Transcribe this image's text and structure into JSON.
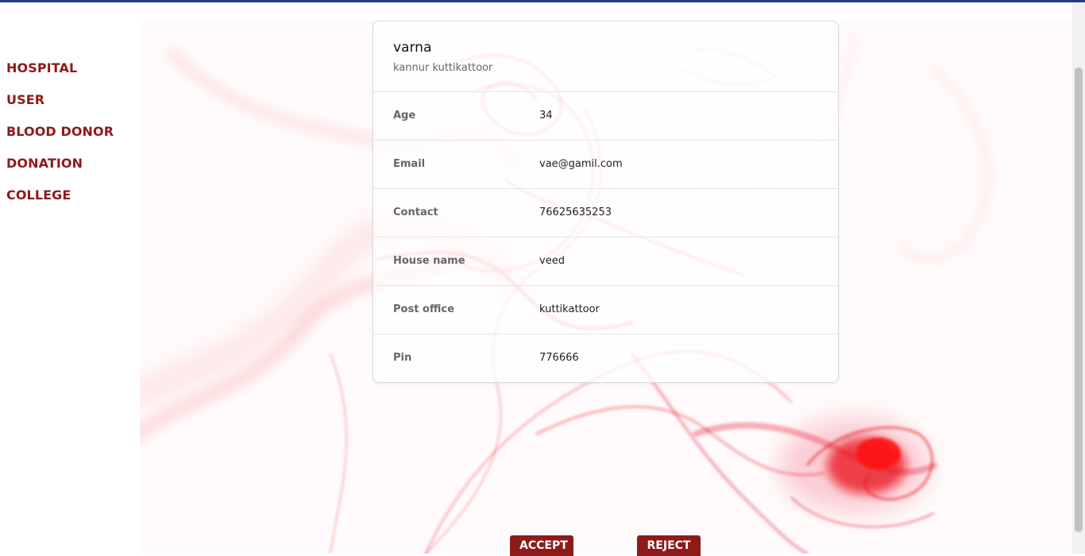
{
  "sidebar": {
    "items": [
      {
        "label": "HOSPITAL"
      },
      {
        "label": "USER"
      },
      {
        "label": "BLOOD DONOR"
      },
      {
        "label": "DONATION"
      },
      {
        "label": "COLLEGE"
      }
    ]
  },
  "profile": {
    "name": "varna",
    "address": "kannur kuttikattoor",
    "fields": [
      {
        "label": "Age",
        "value": "34"
      },
      {
        "label": "Email",
        "value": "vae@gamil.com"
      },
      {
        "label": "Contact",
        "value": "76625635253"
      },
      {
        "label": "House name",
        "value": "veed"
      },
      {
        "label": "Post office",
        "value": "kuttikattoor"
      },
      {
        "label": "Pin",
        "value": "776666"
      }
    ]
  },
  "actions": {
    "accept_label": "ACCEPT",
    "reject_label": "REJECT"
  },
  "colors": {
    "accent": "#8e1a1a",
    "top_bar": "#1f3f82",
    "smoke": "#e8101a"
  }
}
